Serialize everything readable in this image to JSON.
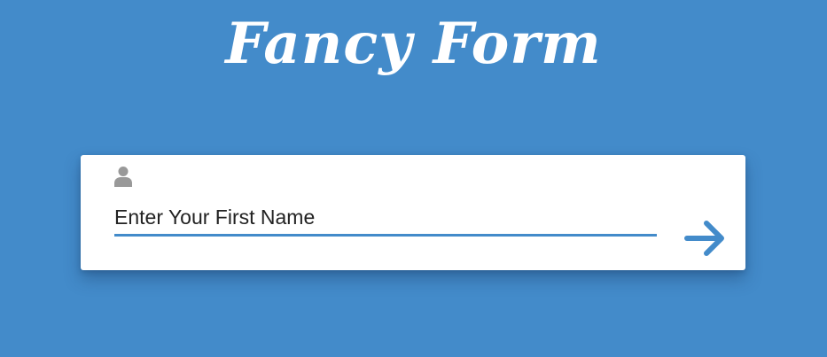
{
  "page": {
    "title": "Fancy Form"
  },
  "form": {
    "field_label": "Enter Your First Name"
  },
  "icons": {
    "field_icon": "user-icon",
    "submit_icon": "arrow-right-icon"
  },
  "colors": {
    "background": "#438bca",
    "card": "#ffffff",
    "accent": "#438bca",
    "icon_gray": "#999999",
    "text": "#222222"
  }
}
